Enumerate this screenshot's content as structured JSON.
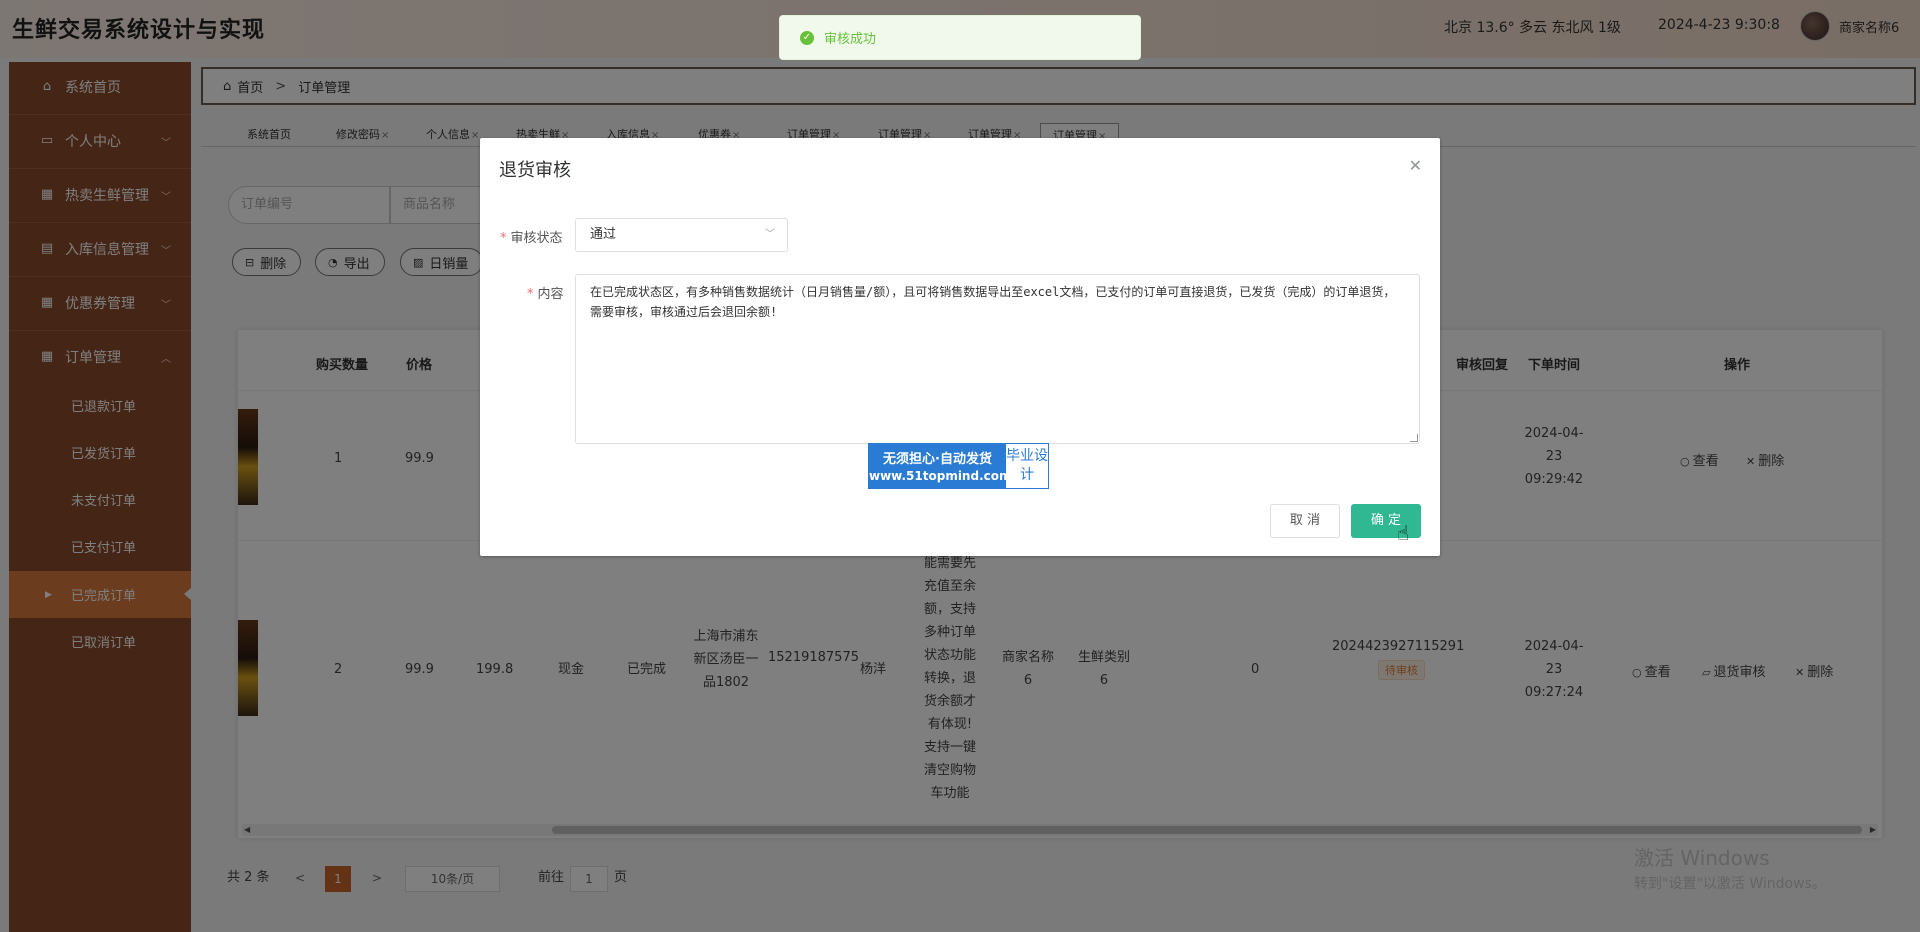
{
  "header": {
    "app_title": "生鲜交易系统设计与实现",
    "weather": "北京  13.6°  多云  东北风  1级",
    "datetime": "2024-4-23 9:30:8",
    "merchant_name": "商家名称6"
  },
  "sidebar": {
    "items": [
      {
        "label": "系统首页",
        "icon": "home-icon"
      },
      {
        "label": "个人中心",
        "icon": "calendar-icon"
      },
      {
        "label": "热卖生鲜管理",
        "icon": "grid-icon"
      },
      {
        "label": "入库信息管理",
        "icon": "clipboard-icon"
      },
      {
        "label": "优惠券管理",
        "icon": "grid-icon"
      },
      {
        "label": "订单管理",
        "icon": "grid-icon"
      }
    ],
    "sub_items": [
      "已退款订单",
      "已发货订单",
      "未支付订单",
      "已支付订单",
      "已完成订单",
      "已取消订单"
    ]
  },
  "breadcrumb": {
    "home": "首页",
    "current": "订单管理"
  },
  "tabs": [
    {
      "label": "系统首页",
      "closable": false
    },
    {
      "label": "修改密码",
      "closable": true
    },
    {
      "label": "个人信息",
      "closable": true
    },
    {
      "label": "热卖生鲜",
      "closable": true
    },
    {
      "label": "入库信息",
      "closable": true
    },
    {
      "label": "优惠券",
      "closable": true
    },
    {
      "label": "订单管理",
      "closable": true
    },
    {
      "label": "订单管理",
      "closable": true
    },
    {
      "label": "订单管理",
      "closable": true
    },
    {
      "label": "订单管理",
      "closable": true
    }
  ],
  "search": {
    "order_no_placeholder": "订单编号",
    "product_name_placeholder": "商品名称"
  },
  "actions": {
    "delete": "删除",
    "export": "导出",
    "daily_sales": "日销量"
  },
  "table": {
    "headers": {
      "qty": "购买数量",
      "price": "价格",
      "review_reply": "审核回复",
      "order_time": "下单时间",
      "operations": "操作"
    },
    "rows": [
      {
        "qty": "1",
        "price": "99.9",
        "order_time": "2024-04-23 09:29:42",
        "ops": [
          "查看",
          "删除"
        ]
      },
      {
        "qty": "2",
        "price": "99.9",
        "total": "199.8",
        "payment": "现金",
        "status": "已完成",
        "address": "上海市浦东新区汤臣一品1802",
        "phone": "15219187575",
        "receiver": "杨洋",
        "remark": "能需要先充值至余额，支持多种订单状态功能转换，退货余额才有体现!支持一键清空购物车功能",
        "merchant": "商家名称6",
        "category": "生鲜类别6",
        "count": "0",
        "order_no": "2024423927115291",
        "review_status": "待审核",
        "order_time": "2024-04-23 09:27:24",
        "ops": [
          "查看",
          "退货审核",
          "删除"
        ]
      }
    ]
  },
  "pagination": {
    "total": "共 2 条",
    "prev": "<",
    "page": "1",
    "next": ">",
    "page_size": "10条/页",
    "goto": "前往",
    "goto_value": "1",
    "page_unit": "页"
  },
  "windows": {
    "line1": "激活 Windows",
    "line2": "转到\"设置\"以激活 Windows。"
  },
  "toast": {
    "message": "审核成功",
    "color": "#67c23a"
  },
  "dialog": {
    "title": "退货审核",
    "status_label": "审核状态",
    "status_value": "通过",
    "content_label": "内容",
    "content_value": "在已完成状态区，有多种销售数据统计（日月销售量/额），且可将销售数据导出至excel文档，已支付的订单可直接退货，已发货（完成）的订单退货，需要审核，审核通过后会退回余额!",
    "cancel": "取 消",
    "confirm": "确 定",
    "confirm_color": "#2fb892"
  },
  "promo": {
    "line1": "无须担心·自动发货",
    "line2": "www.51topmind.com",
    "side": "毕业设计"
  },
  "colors": {
    "sidebar_bg": "#8a4a2a",
    "sidebar_active": "#d67a3c",
    "accent": "#c8642a"
  }
}
